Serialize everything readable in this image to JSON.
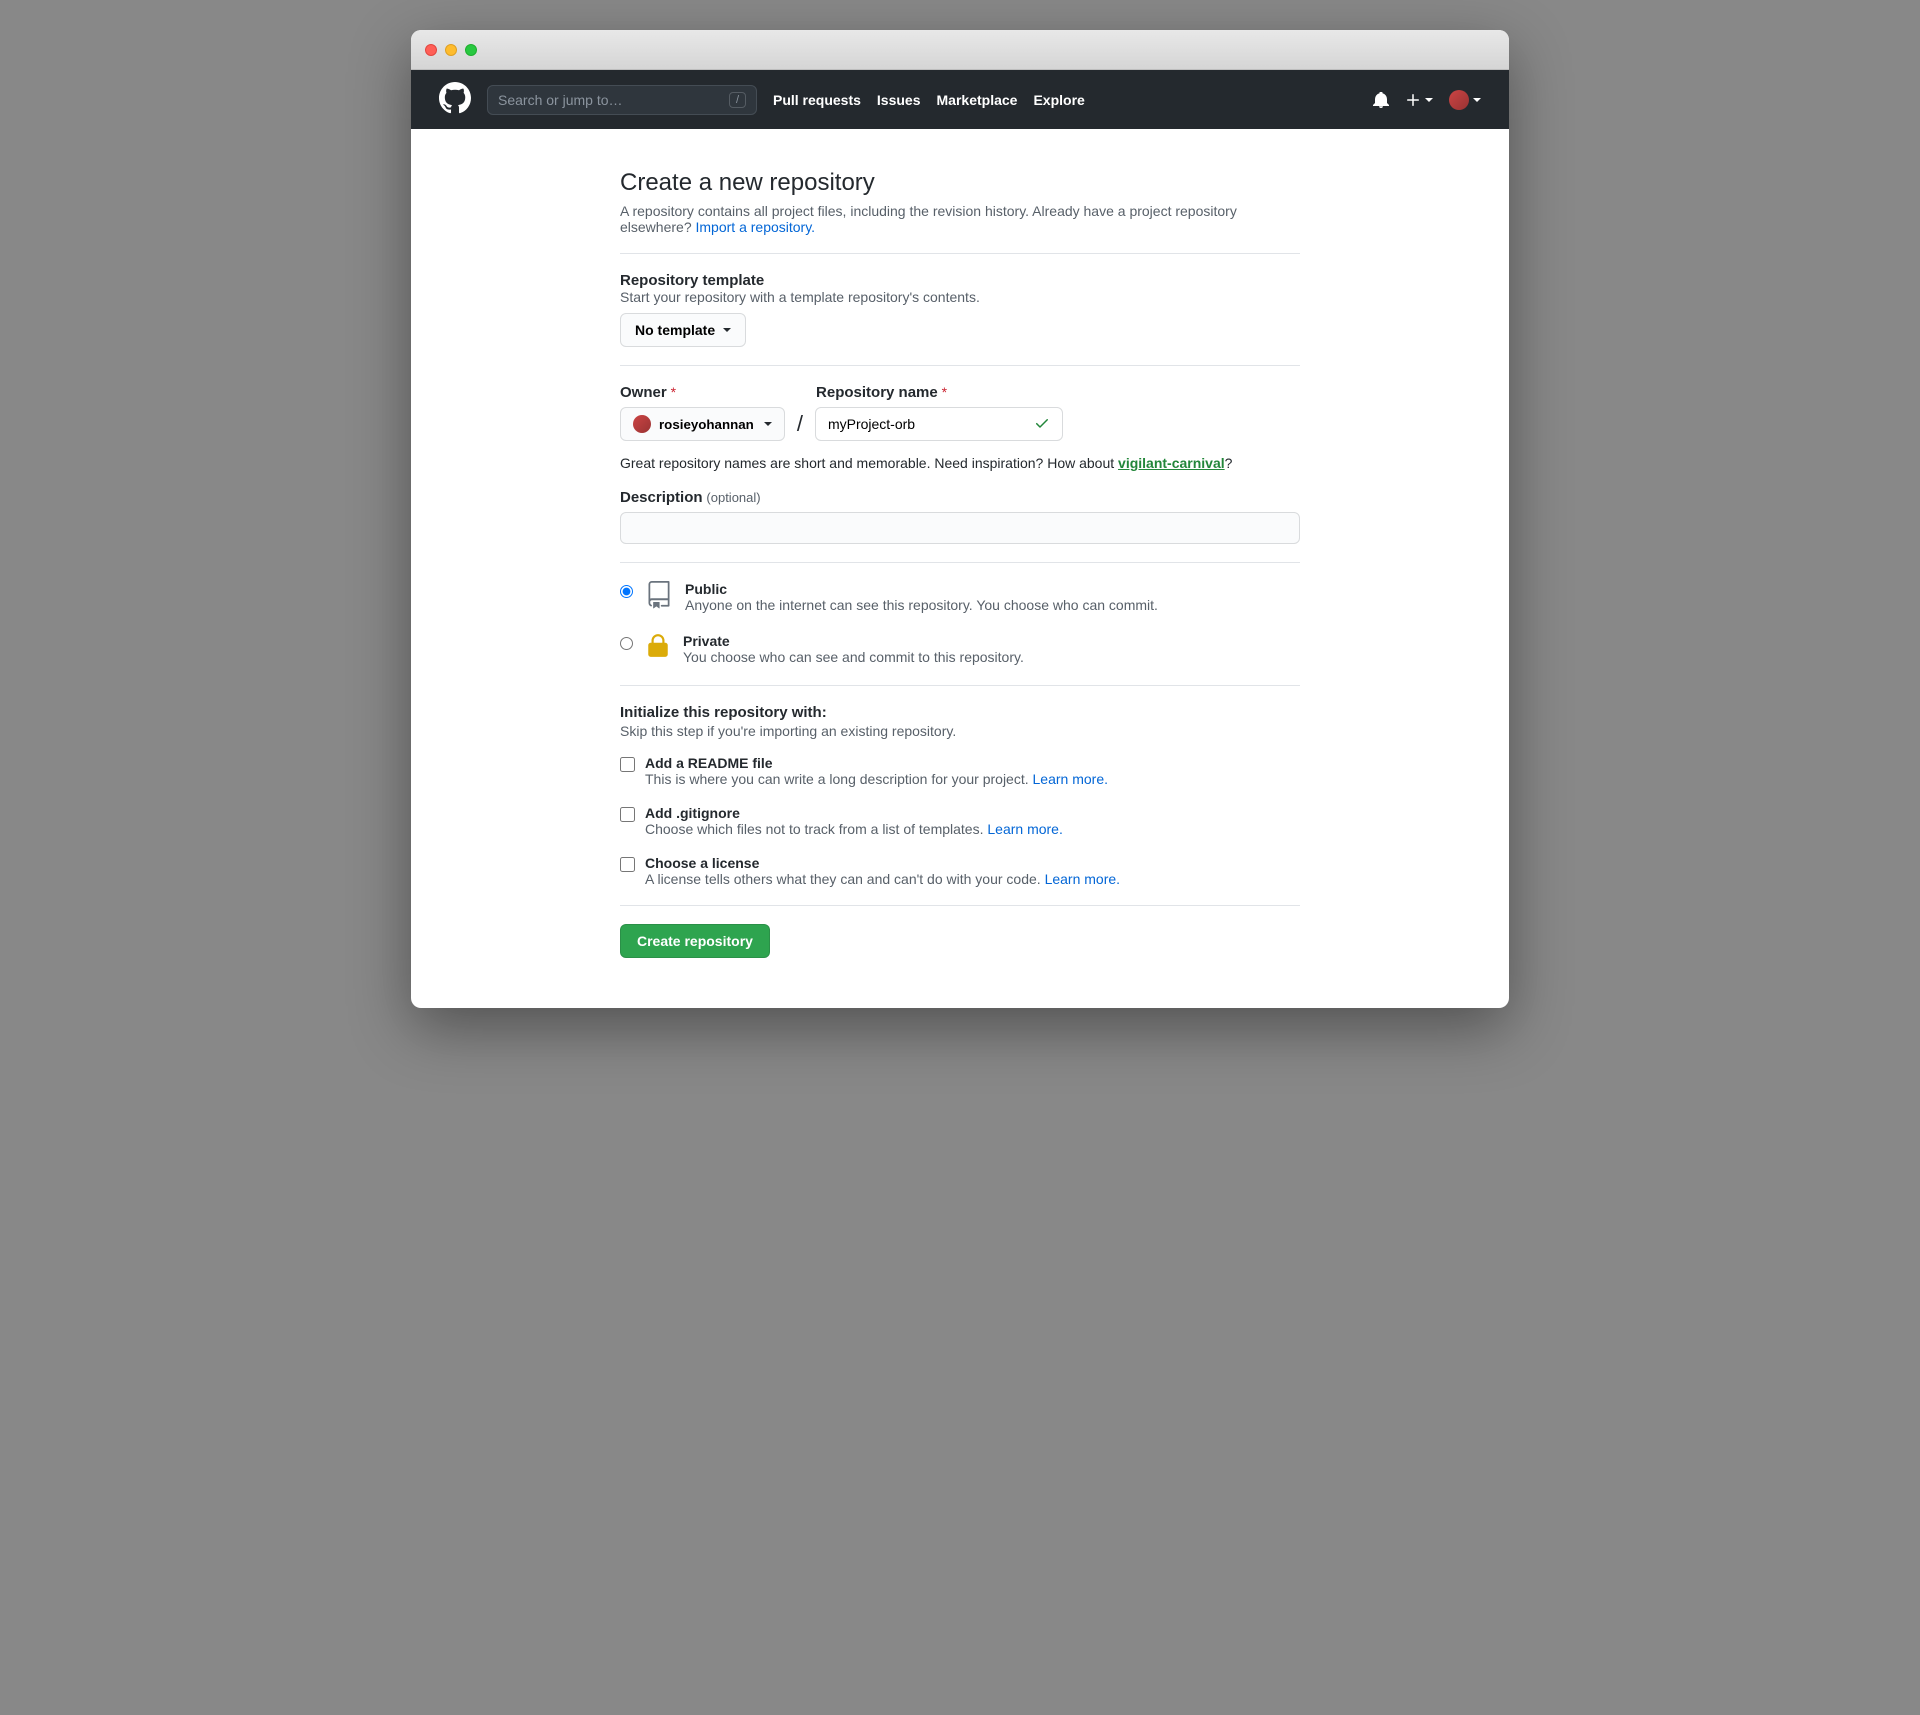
{
  "search": {
    "placeholder": "Search or jump to…",
    "key": "/"
  },
  "nav": {
    "pull_requests": "Pull requests",
    "issues": "Issues",
    "marketplace": "Marketplace",
    "explore": "Explore"
  },
  "page": {
    "title": "Create a new repository",
    "desc_1": "A repository contains all project files, including the revision history. Already have a project repository elsewhere? ",
    "import_link": "Import a repository."
  },
  "template": {
    "label": "Repository template",
    "desc": "Start your repository with a template repository's contents.",
    "selected": "No template"
  },
  "owner": {
    "label": "Owner",
    "name": "rosieyohannan"
  },
  "repo": {
    "label": "Repository name",
    "value": "myProject-orb"
  },
  "hint": {
    "pre": "Great repository names are short and memorable. Need inspiration? How about ",
    "suggestion": "vigilant-carnival",
    "post": "?"
  },
  "description": {
    "label": "Description",
    "optional": "(optional)"
  },
  "visibility": {
    "public": {
      "title": "Public",
      "desc": "Anyone on the internet can see this repository. You choose who can commit."
    },
    "private": {
      "title": "Private",
      "desc": "You choose who can see and commit to this repository."
    }
  },
  "init": {
    "heading": "Initialize this repository with:",
    "sub": "Skip this step if you're importing an existing repository.",
    "readme": {
      "title": "Add a README file",
      "desc": "This is where you can write a long description for your project. ",
      "learn": "Learn more."
    },
    "gitignore": {
      "title": "Add .gitignore",
      "desc": "Choose which files not to track from a list of templates. ",
      "learn": "Learn more."
    },
    "license": {
      "title": "Choose a license",
      "desc": "A license tells others what they can and can't do with your code. ",
      "learn": "Learn more."
    }
  },
  "submit": {
    "label": "Create repository"
  }
}
